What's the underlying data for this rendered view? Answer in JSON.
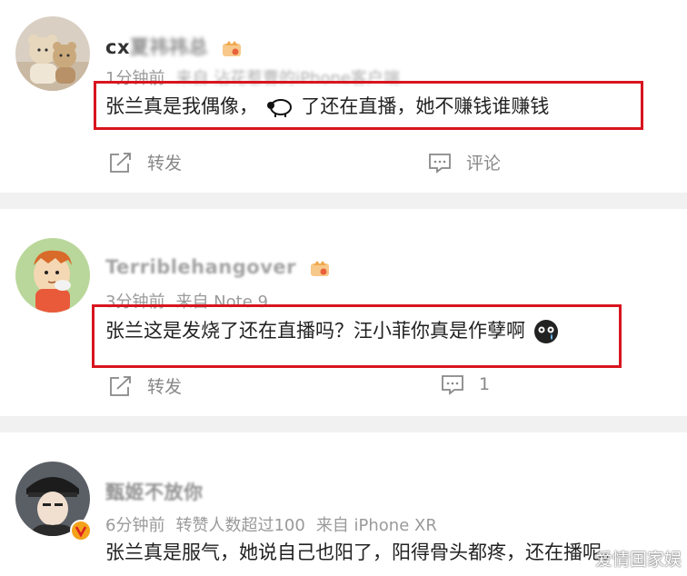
{
  "posts": [
    {
      "username": "cx",
      "username_blurred": "夏祎祎总",
      "time": "1分钟前",
      "source": "来自 沾花惹曹的iPhone客户端",
      "content_before": "张兰真是我偶像，",
      "content_after": "了还在直播，她不赚钱谁赚钱",
      "repost_label": "转发",
      "comment_label": "评论"
    },
    {
      "username": "Terriblehangover",
      "time": "3分钟前",
      "source": "来自 Note 9",
      "content_before": "张兰这是发烧了还在直播吗？汪小菲你真是作孽啊",
      "repost_label": "转发",
      "comment_count": "1"
    },
    {
      "username": "甄姬不放你",
      "time": "6分钟前",
      "reposts": "转赞人数超过100",
      "source": "来自 iPhone XR",
      "content_before": "张兰真是服气，她说自己也阳了，阳得骨头都疼，还在播呢。"
    }
  ],
  "watermark": "爱情国家娱",
  "colors": {
    "highlight_box": "#d8151f",
    "separator": "#f1f1f1",
    "meta": "#9a9a9a"
  },
  "icons": [
    "repost-icon",
    "comment-icon",
    "sheep-emoji-icon",
    "crying-emoji-icon",
    "vip-crown-icon",
    "verified-v-icon"
  ]
}
